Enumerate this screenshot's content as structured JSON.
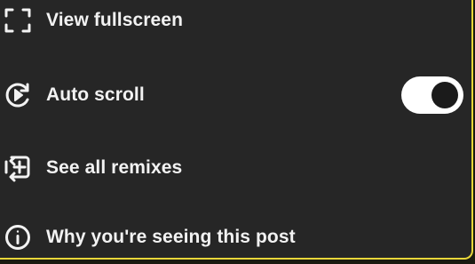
{
  "menu": {
    "items": [
      {
        "icon": "fullscreen-icon",
        "label": "View fullscreen"
      },
      {
        "icon": "autoscroll-icon",
        "label": "Auto scroll"
      },
      {
        "icon": "remix-icon",
        "label": "See all remixes"
      },
      {
        "icon": "info-icon",
        "label": "Why you're seeing this post"
      }
    ],
    "autoscroll_toggle": {
      "state": "on"
    }
  },
  "colors": {
    "background": "#262626",
    "text": "#f2f2f2",
    "toggle_track": "#ffffff",
    "toggle_knob": "#1b1b1b",
    "frame_accent": "#e8d63a"
  }
}
